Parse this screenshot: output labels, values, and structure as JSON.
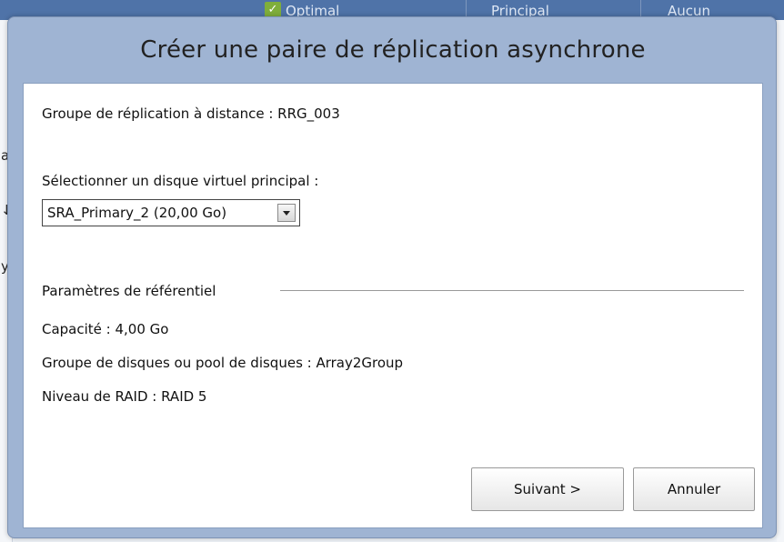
{
  "background": {
    "status_text": "Optimal",
    "role_text": "Principal",
    "none_text": "Aucun",
    "left_fragments": [
      "a",
      "↓",
      "y"
    ]
  },
  "dialog": {
    "title": "Créer une paire de réplication asynchrone",
    "remote_group_label": "Groupe de réplication à distance : RRG_003",
    "select_label": "Sélectionner un disque virtuel principal :",
    "select_value": "SRA_Primary_2 (20,00 Go)",
    "repository_group_title": "Paramètres de référentiel",
    "capacity": "Capacité :  4,00 Go",
    "disk_group": "Groupe de disques ou pool de disques :  Array2Group",
    "raid_level": "Niveau de RAID :  RAID 5",
    "next_button": "Suivant >",
    "cancel_button": "Annuler"
  },
  "colors": {
    "dialog_frame": "#9fb4d3",
    "background_bar": "#4f73a8",
    "status_ok": "#7fae3b"
  }
}
